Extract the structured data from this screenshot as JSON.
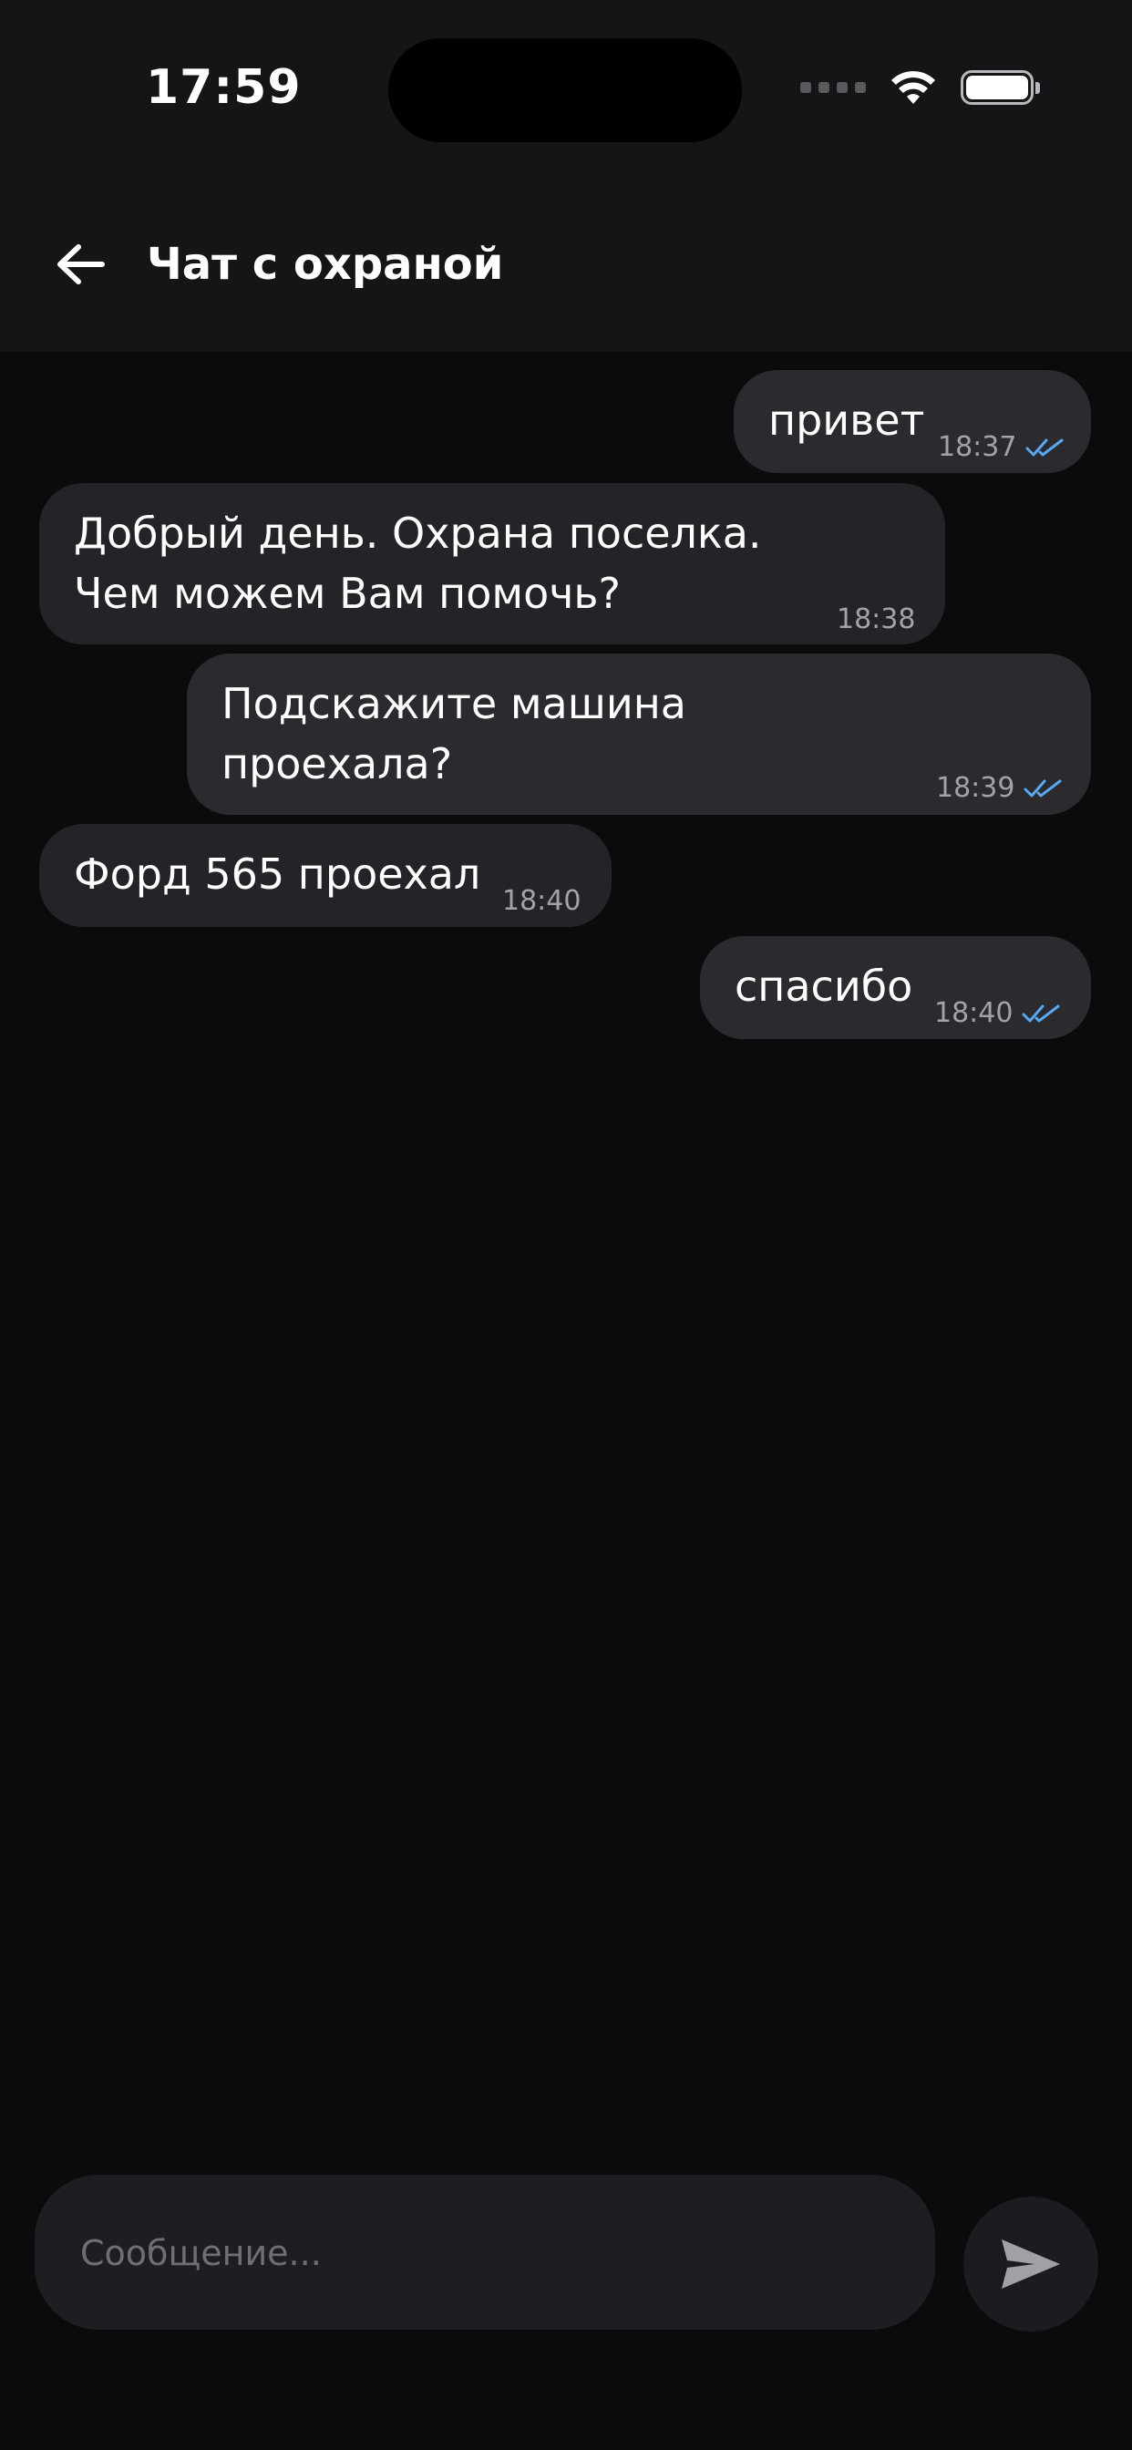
{
  "status_bar": {
    "time": "17:59"
  },
  "header": {
    "title": "Чат с охраной",
    "back_icon": "arrow-left-icon"
  },
  "messages": [
    {
      "direction": "outgoing",
      "text": "привет",
      "time": "18:37",
      "status": "read"
    },
    {
      "direction": "incoming",
      "text": "Добрый день. Охрана поселка.\nЧем можем Вам помочь?",
      "time": "18:38"
    },
    {
      "direction": "outgoing",
      "text": "Подскажите машина\nпроехала?",
      "time": "18:39",
      "status": "read"
    },
    {
      "direction": "incoming",
      "text": "Форд 565 проехал",
      "time": "18:40"
    },
    {
      "direction": "outgoing",
      "text": "спасибо",
      "time": "18:40",
      "status": "read"
    }
  ],
  "composer": {
    "value": "",
    "placeholder": "Сообщение...",
    "send_icon": "send-icon"
  },
  "colors": {
    "background": "#0b0b0c",
    "header_background": "#151517",
    "bubble": "#2a2a2f",
    "read_ticks": "#5aa8f0"
  }
}
